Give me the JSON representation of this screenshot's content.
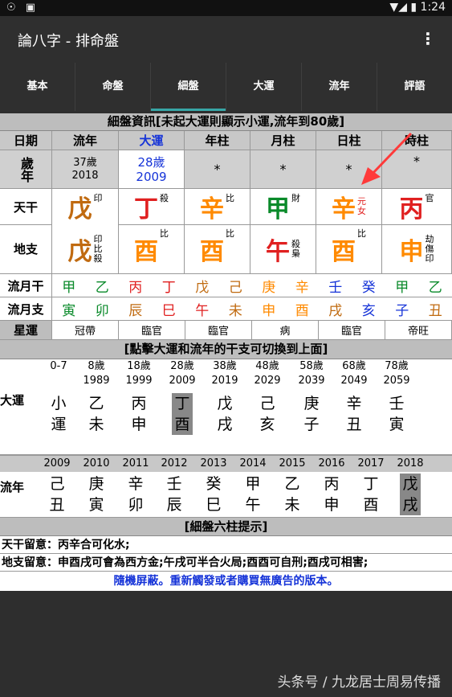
{
  "status": {
    "left": "☉ ▣",
    "right": "▼◢ ▮ 1:24"
  },
  "app": {
    "title": "論八字 - 排命盤"
  },
  "tabs": [
    "基本",
    "命盤",
    "細盤",
    "大運",
    "流年",
    "評語"
  ],
  "info_title": "細盤資訊[未起大運則顯示小運,流年到80歲]",
  "headers": [
    "日期",
    "流年",
    "大運",
    "年柱",
    "月柱",
    "日柱",
    "時柱"
  ],
  "age_row": {
    "label": "歲年",
    "ly_age": "37歲",
    "ly_year": "2018",
    "dy_age": "28歲",
    "dy_year": "2009",
    "star": "*"
  },
  "tiangan": {
    "label": "天干",
    "cells": [
      {
        "char": "戊",
        "color": "#c06a10",
        "sup": "印"
      },
      {
        "char": "丁",
        "color": "#e02020",
        "sup": "殺"
      },
      {
        "char": "辛",
        "color": "#ff8a00",
        "sup": "比"
      },
      {
        "char": "甲",
        "color": "#0a8a2a",
        "sup": "財"
      },
      {
        "char": "辛",
        "color": "#ff8a00",
        "sup": "元女",
        "supcolor": "#e02020"
      },
      {
        "char": "丙",
        "color": "#e02020",
        "sup": "官"
      }
    ]
  },
  "dizhi": {
    "label": "地支",
    "cells": [
      {
        "char": "戊",
        "color": "#c06a10",
        "sup": "印比殺"
      },
      {
        "char": "酉",
        "color": "#ff8a00",
        "sup": "比"
      },
      {
        "char": "酉",
        "color": "#ff8a00",
        "sup": "比"
      },
      {
        "char": "午",
        "color": "#e02020",
        "sup": "殺梟"
      },
      {
        "char": "酉",
        "color": "#ff8a00",
        "sup": "比"
      },
      {
        "char": "申",
        "color": "#ff8a00",
        "sup": "劫傷印"
      }
    ]
  },
  "lym_gan": {
    "label": "流月干",
    "chars": [
      "甲",
      "乙",
      "丙",
      "丁",
      "戊",
      "己",
      "庚",
      "辛",
      "壬",
      "癸",
      "甲",
      "乙"
    ],
    "colors": [
      "#0a8a2a",
      "#0a8a2a",
      "#e02020",
      "#e02020",
      "#c06a10",
      "#c06a10",
      "#ff8a00",
      "#ff8a00",
      "#1533d8",
      "#1533d8",
      "#0a8a2a",
      "#0a8a2a"
    ]
  },
  "lym_zhi": {
    "label": "流月支",
    "chars": [
      "寅",
      "卯",
      "辰",
      "巳",
      "午",
      "未",
      "申",
      "酉",
      "戌",
      "亥",
      "子",
      "丑"
    ],
    "colors": [
      "#0a8a2a",
      "#0a8a2a",
      "#c06a10",
      "#e02020",
      "#e02020",
      "#c06a10",
      "#ff8a00",
      "#ff8a00",
      "#c06a10",
      "#1533d8",
      "#1533d8",
      "#c06a10"
    ]
  },
  "xingyun": {
    "label": "星運",
    "cells": [
      "冠帶",
      "臨官",
      "臨官",
      "病",
      "臨官",
      "帝旺"
    ]
  },
  "dy_title": "[點擊大運和流年的干支可切換到上面]",
  "dayun": {
    "label": "大運",
    "ages": [
      "0-7",
      "8歲",
      "18歲",
      "28歲",
      "38歲",
      "48歲",
      "58歲",
      "68歲",
      "78歲"
    ],
    "years": [
      "",
      "1989",
      "1999",
      "2009",
      "2019",
      "2029",
      "2039",
      "2049",
      "2059"
    ],
    "gan": [
      "小",
      "乙",
      "丙",
      "丁",
      "戊",
      "己",
      "庚",
      "辛",
      "壬"
    ],
    "zhi": [
      "運",
      "未",
      "申",
      "酉",
      "戌",
      "亥",
      "子",
      "丑",
      "寅"
    ],
    "selected": 3
  },
  "liunian": {
    "label": "流年",
    "years": [
      "2009",
      "2010",
      "2011",
      "2012",
      "2013",
      "2014",
      "2015",
      "2016",
      "2017",
      "2018"
    ],
    "gan": [
      "己",
      "庚",
      "辛",
      "壬",
      "癸",
      "甲",
      "乙",
      "丙",
      "丁",
      "戊"
    ],
    "zhi": [
      "丑",
      "寅",
      "卯",
      "辰",
      "巳",
      "午",
      "未",
      "申",
      "酉",
      "戌"
    ],
    "selected": 9
  },
  "tips_title": "[細盤六柱提示]",
  "tip1": "天干留意：丙辛合可化水;",
  "tip2": "地支留意：申酉戌可會為西方金;午戌可半合火局;酉酉可自刑;酉戌可相害;",
  "ad": "隨機屏蔽。重新觸發或者購買無廣告的版本。",
  "watermark": "头条号 / 九龙居士周易传播"
}
